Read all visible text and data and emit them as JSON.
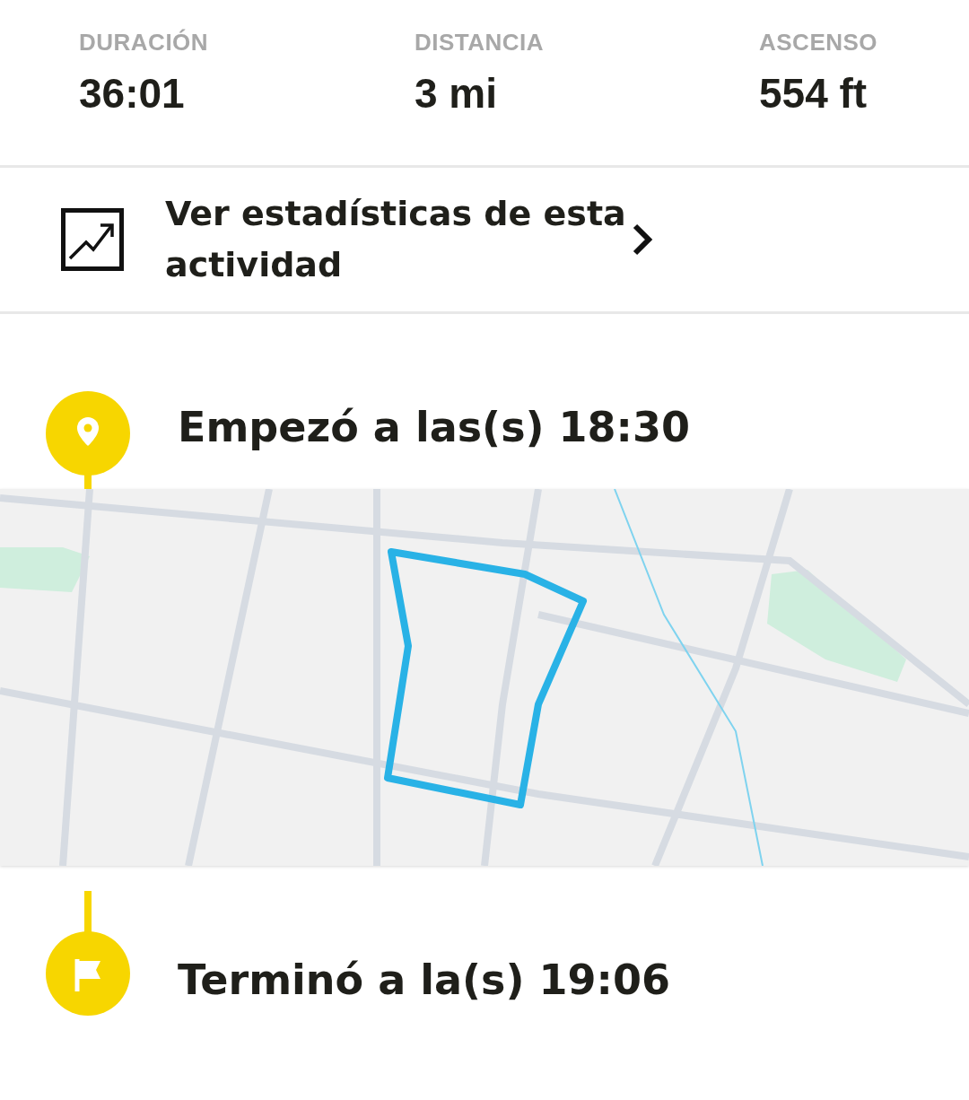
{
  "stats": [
    {
      "label": "DURACIÓN",
      "value": "36:01"
    },
    {
      "label": "DISTANCIA",
      "value": "3 mi"
    },
    {
      "label": "ASCENSO",
      "value": "554 ft"
    }
  ],
  "stats_link": {
    "label": "Ver estadísticas de esta actividad"
  },
  "start": {
    "text": "Empezó a las(s) 18:30"
  },
  "end": {
    "text": "Terminó a la(s) 19:06"
  }
}
